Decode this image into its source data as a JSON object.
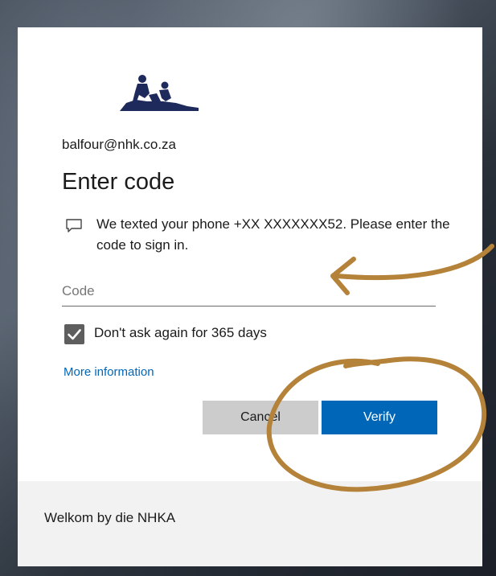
{
  "account": {
    "email": "balfour@nhk.co.za"
  },
  "heading": {
    "title": "Enter code"
  },
  "message": {
    "icon": "chat-bubble-icon",
    "text": "We texted your phone +XX XXXXXXX52. Please enter the code to sign in."
  },
  "code_field": {
    "placeholder": "Code",
    "value": ""
  },
  "remember": {
    "label": "Don't ask again for 365 days",
    "checked": true
  },
  "links": {
    "more_info": "More information"
  },
  "buttons": {
    "cancel": "Cancel",
    "verify": "Verify"
  },
  "footer": {
    "text": "Welkom by die NHKA"
  },
  "colors": {
    "accent": "#0067b8",
    "annotation": "#b5823a",
    "logo": "#1f2a5c",
    "cancel_bg": "#cccccc",
    "footer_bg": "#f2f2f2"
  }
}
